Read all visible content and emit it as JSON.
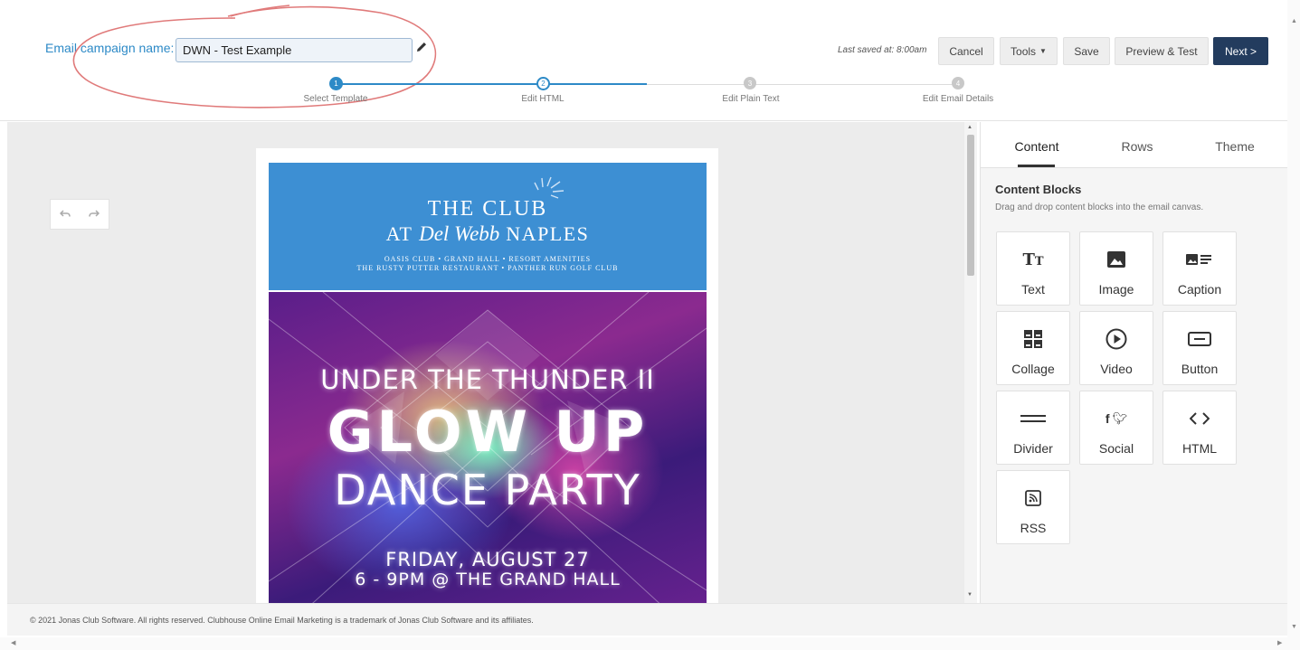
{
  "header": {
    "campaign_label": "Email campaign name:",
    "campaign_name_value": "DWN - Test Example",
    "last_saved": "Last saved at: 8:00am",
    "buttons": {
      "cancel": "Cancel",
      "tools": "Tools",
      "save": "Save",
      "preview_test": "Preview & Test",
      "next": "Next >"
    },
    "annotation_color": "#e07a7a"
  },
  "stepper": {
    "steps": [
      {
        "number": "1",
        "label": "Select Template",
        "state": "complete"
      },
      {
        "number": "2",
        "label": "Edit HTML",
        "state": "current"
      },
      {
        "number": "3",
        "label": "Edit Plain Text",
        "state": "upcoming"
      },
      {
        "number": "4",
        "label": "Edit Email Details",
        "state": "upcoming"
      }
    ],
    "active_color": "#2d8ac7",
    "inactive_color": "#c8c8c8"
  },
  "canvas": {
    "undo_icon": "undo-icon",
    "redo_icon": "redo-icon",
    "email": {
      "header_bg": "#3d8fd3",
      "club_line1": "THE CLUB",
      "club_line2_prefix": "AT",
      "club_line2_script": "Del Webb",
      "club_line2_suffix": "NAPLES",
      "club_line3": "OASIS CLUB • GRAND HALL • RESORT AMENITIES",
      "club_line4": "THE RUSTY PUTTER RESTAURANT • PANTHER RUN GOLF CLUB",
      "event_line1": "UNDER THE THUNDER II",
      "event_line2": "GLOW UP",
      "event_line3": "DANCE PARTY",
      "event_line4": "FRIDAY, AUGUST 27",
      "event_line5": "6 - 9PM @ THE GRAND HALL"
    }
  },
  "panel": {
    "tabs": [
      "Content",
      "Rows",
      "Theme"
    ],
    "active_tab": "Content",
    "content_blocks_title": "Content Blocks",
    "content_blocks_desc": "Drag and drop content blocks into the email canvas.",
    "blocks": [
      {
        "label": "Text",
        "icon": "text-icon"
      },
      {
        "label": "Image",
        "icon": "image-icon"
      },
      {
        "label": "Caption",
        "icon": "caption-icon"
      },
      {
        "label": "Collage",
        "icon": "collage-icon"
      },
      {
        "label": "Video",
        "icon": "video-icon"
      },
      {
        "label": "Button",
        "icon": "button-icon"
      },
      {
        "label": "Divider",
        "icon": "divider-icon"
      },
      {
        "label": "Social",
        "icon": "social-icon"
      },
      {
        "label": "HTML",
        "icon": "code-icon"
      },
      {
        "label": "RSS",
        "icon": "rss-icon"
      }
    ]
  },
  "footer": {
    "copyright": "© 2021 Jonas Club Software. All rights reserved. Clubhouse Online Email Marketing is a trademark of Jonas Club Software and its affiliates."
  }
}
